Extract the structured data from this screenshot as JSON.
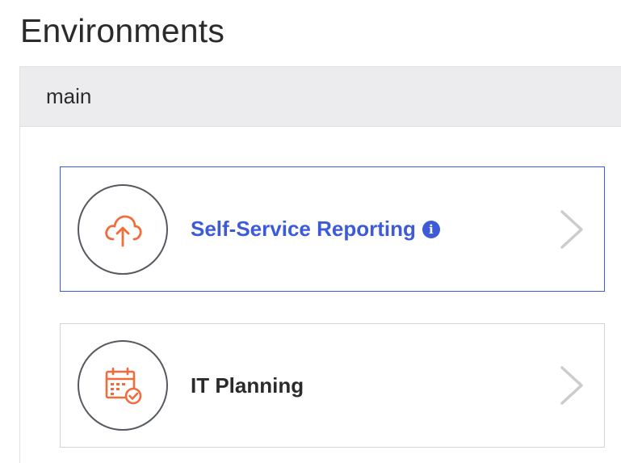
{
  "page": {
    "title": "Environments"
  },
  "panel": {
    "header": "main"
  },
  "environments": [
    {
      "label": "Self-Service Reporting",
      "icon": "cloud-upload-icon",
      "info_icon": "info-icon",
      "selected": true,
      "color": "#3d5bd9"
    },
    {
      "label": "IT Planning",
      "icon": "calendar-check-icon",
      "selected": false,
      "color": "#2b2b2b"
    }
  ],
  "colors": {
    "accent": "#3d5bd9",
    "icon_orange": "#f26b3a",
    "card_border": "#d4d4d4",
    "header_bg": "#ececee"
  }
}
